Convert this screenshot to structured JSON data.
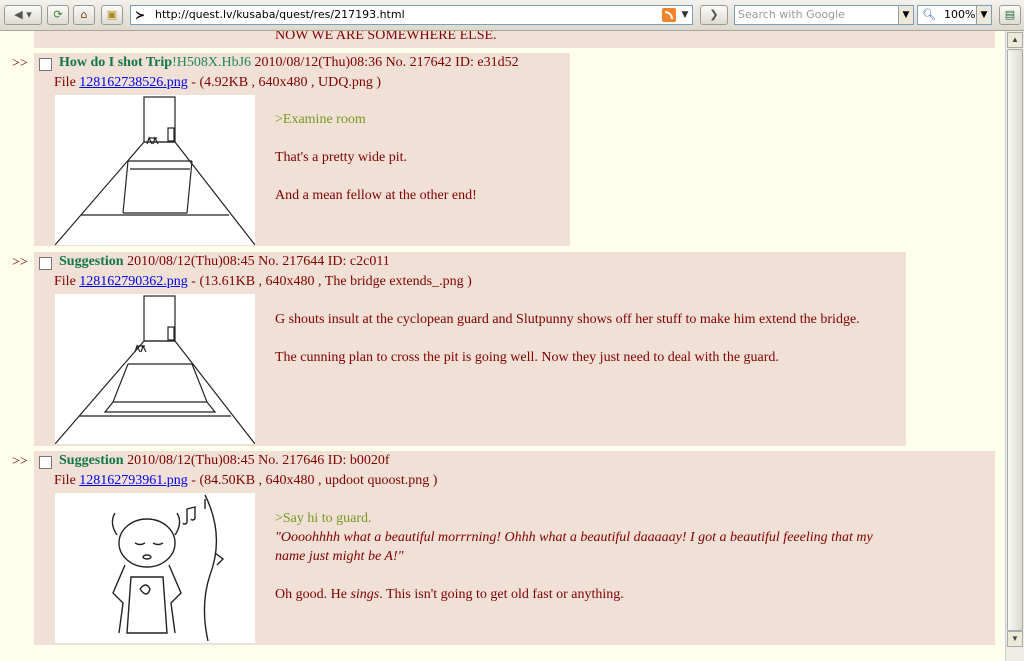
{
  "browser": {
    "url": "http://quest.lv/kusaba/quest/res/217193.html",
    "search_placeholder": "Search with Google",
    "zoom": "100%"
  },
  "top_text": "NOW WE ARE SOMEWHERE ELSE.",
  "posts": [
    {
      "arrows": ">>",
      "name": "How do I shot Trip",
      "trip": "!H508X.HbJ6",
      "meta": "2010/08/12(Thu)08:36 No. 217642 ID: e31d52",
      "file_prefix": "File",
      "file_link": "128162738526.png",
      "file_info": "- (4.92KB , 640x480 , UDQ.png )",
      "lines": [
        ">Examine room",
        "That's a pretty wide pit.",
        "And a mean fellow at the other end!"
      ]
    },
    {
      "arrows": ">>",
      "name": "Suggestion",
      "meta": "2010/08/12(Thu)08:45 No. 217644 ID: c2c011",
      "file_prefix": "File",
      "file_link": "128162790362.png",
      "file_info": "- (13.61KB , 640x480 , The bridge extends_.png )",
      "lines": [
        "G shouts insult at the cyclopean guard and Slutpunny shows off her stuff to make him extend the bridge.",
        "The cunning plan to cross the pit is going well. Now they just need to deal with the guard."
      ]
    },
    {
      "arrows": ">>",
      "name": "Suggestion",
      "meta": "2010/08/12(Thu)08:45 No. 217646 ID: b0020f",
      "file_prefix": "File",
      "file_link": "128162793961.png",
      "file_info": "- (84.50KB , 640x480 , updoot quoost.png )",
      "lines": [
        ">Say hi to guard.",
        "\"Oooohhhh what a beautiful morrrning! Ohhh what a beautiful daaaaay! I got a beautiful feeeling that my",
        "name just might be A!\"",
        "Oh good. He ",
        "sings",
        ". This isn't going to get old fast or anything."
      ]
    }
  ]
}
